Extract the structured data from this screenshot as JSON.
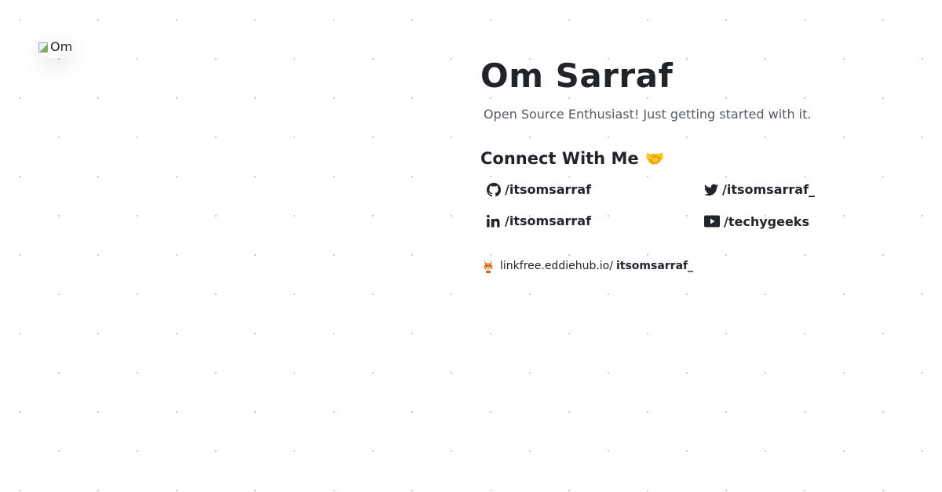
{
  "profile": {
    "avatar_alt": "Om",
    "name": "Om Sarraf",
    "bio": "Open Source Enthusiast! Just getting started with it."
  },
  "connect": {
    "heading": "Connect With Me",
    "emoji": "🤝"
  },
  "socials": {
    "github": {
      "label": "/itsomsarraf",
      "icon": "github-icon"
    },
    "twitter": {
      "label": "/itsomsarraf_",
      "icon": "twitter-icon"
    },
    "linkedin": {
      "label": "/itsomsarraf",
      "icon": "linkedin-icon"
    },
    "youtube": {
      "label": "/techygeeks",
      "icon": "youtube-icon"
    }
  },
  "linkfree": {
    "icon": "linkfree-fox-icon",
    "domain": "linkfree.eddiehub.io/",
    "username": "itsomsarraf_"
  },
  "colors": {
    "text": "#212529",
    "muted": "#555b61",
    "dots": "#c9c9c9",
    "background": "#ffffff"
  }
}
